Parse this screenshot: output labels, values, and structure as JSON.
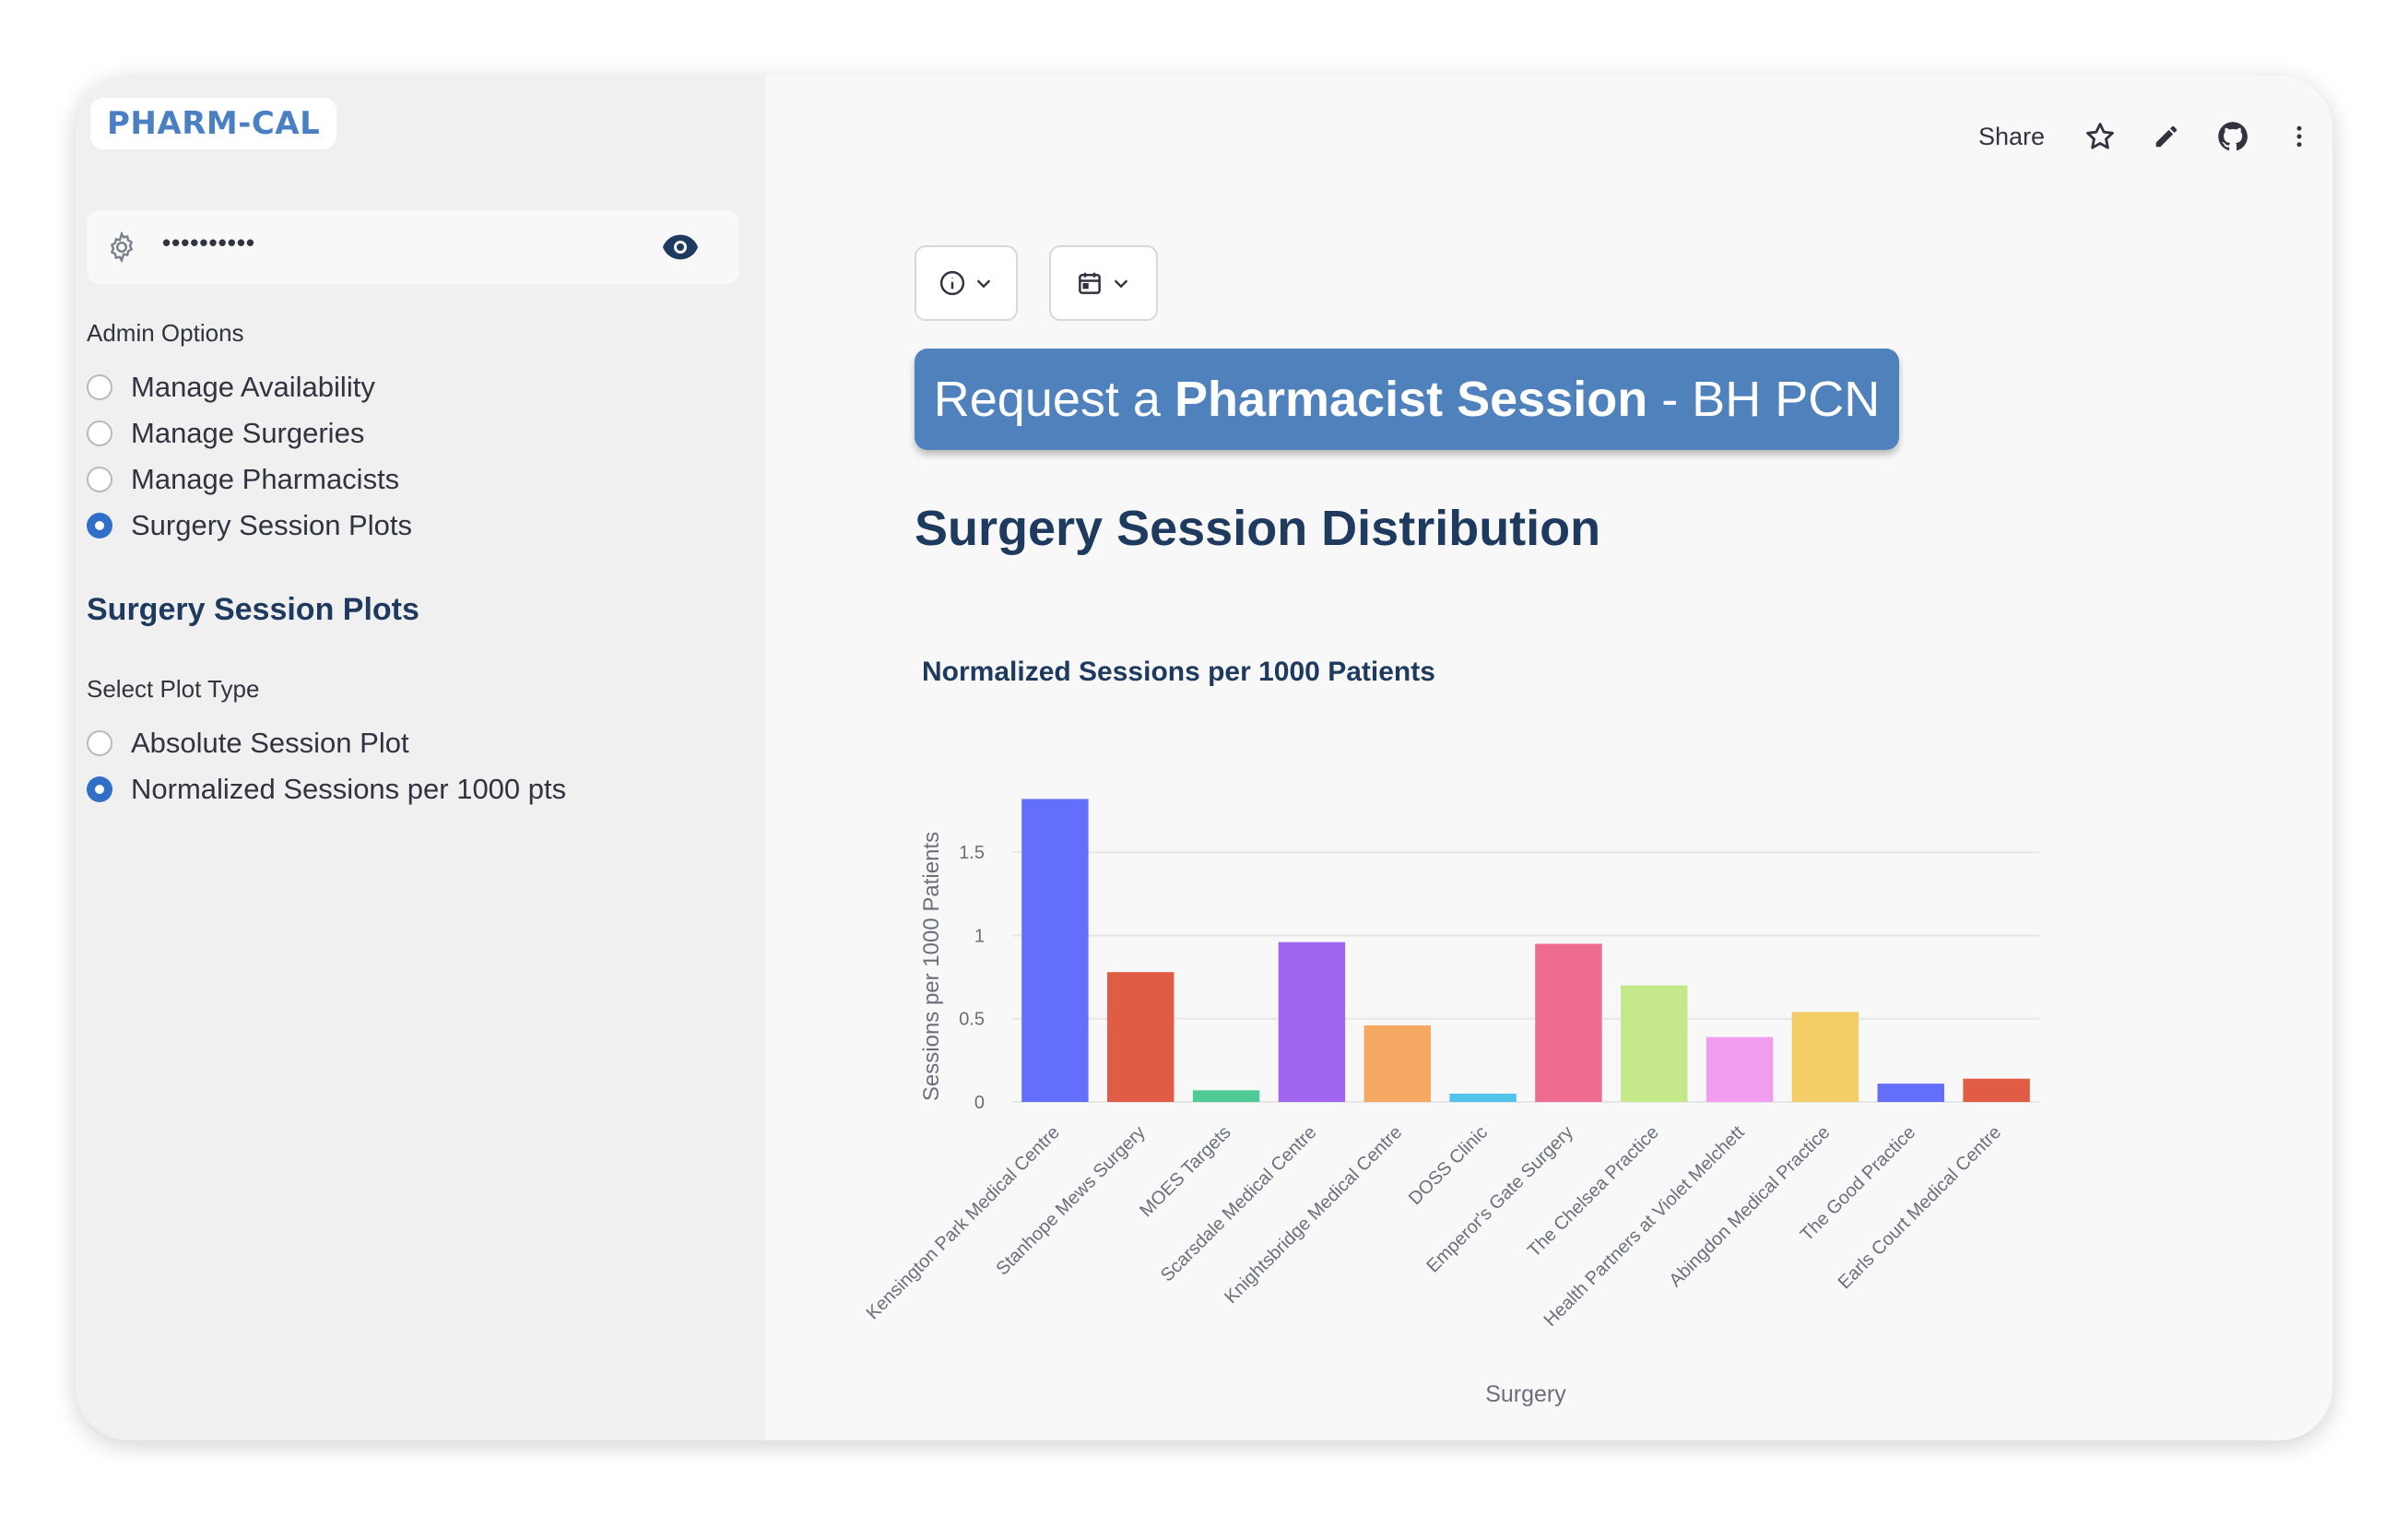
{
  "sidebar": {
    "logo": "PHARM-CAL",
    "password_mask": "••••••••••",
    "admin_options_label": "Admin Options",
    "admin_options": [
      {
        "label": "Manage Availability",
        "selected": false
      },
      {
        "label": "Manage Surgeries",
        "selected": false
      },
      {
        "label": "Manage Pharmacists",
        "selected": false
      },
      {
        "label": "Surgery Session Plots",
        "selected": true
      }
    ],
    "section_title": "Surgery Session Plots",
    "plot_type_label": "Select Plot Type",
    "plot_types": [
      {
        "label": "Absolute Session Plot",
        "selected": false
      },
      {
        "label": "Normalized Sessions per 1000 pts",
        "selected": true
      }
    ]
  },
  "toolbar": {
    "share_label": "Share",
    "icons": [
      "star-icon",
      "pencil-icon",
      "github-icon",
      "more-vertical-icon"
    ]
  },
  "main": {
    "banner_prefix": "Request a ",
    "banner_bold": "Pharmacist Session",
    "banner_suffix": " - BH PCN",
    "heading": "Surgery Session Distribution"
  },
  "chart_data": {
    "type": "bar",
    "title": "Normalized Sessions per 1000 Patients",
    "xlabel": "Surgery",
    "ylabel": "Sessions per 1000 Patients",
    "ylim": [
      0,
      1.85
    ],
    "yticks": [
      0,
      0.5,
      1,
      1.5
    ],
    "ytick_labels": [
      "0",
      "0.5",
      "1",
      "1.5"
    ],
    "grid": true,
    "categories": [
      "Kensington Park Medical Centre",
      "Stanhope Mews Surgery",
      "MOES Targets",
      "Scarsdale Medical Centre",
      "Knightsbridge Medical Centre",
      "DOSS Clinic",
      "Emperor's Gate Surgery",
      "The Chelsea Practice",
      "Health Partners at Violet Melchett",
      "Abingdon Medical Practice",
      "The Good Practice",
      "Earls Court Medical Centre"
    ],
    "values": [
      1.82,
      0.78,
      0.07,
      0.96,
      0.46,
      0.05,
      0.95,
      0.7,
      0.39,
      0.54,
      0.11,
      0.14
    ],
    "colors": [
      "#636efa",
      "#e05c45",
      "#4fc996",
      "#a066f0",
      "#f4a862",
      "#4fc3ea",
      "#ee6c8f",
      "#c4e88a",
      "#f19ef0",
      "#f5cd66",
      "#636efa",
      "#e05c45"
    ]
  }
}
